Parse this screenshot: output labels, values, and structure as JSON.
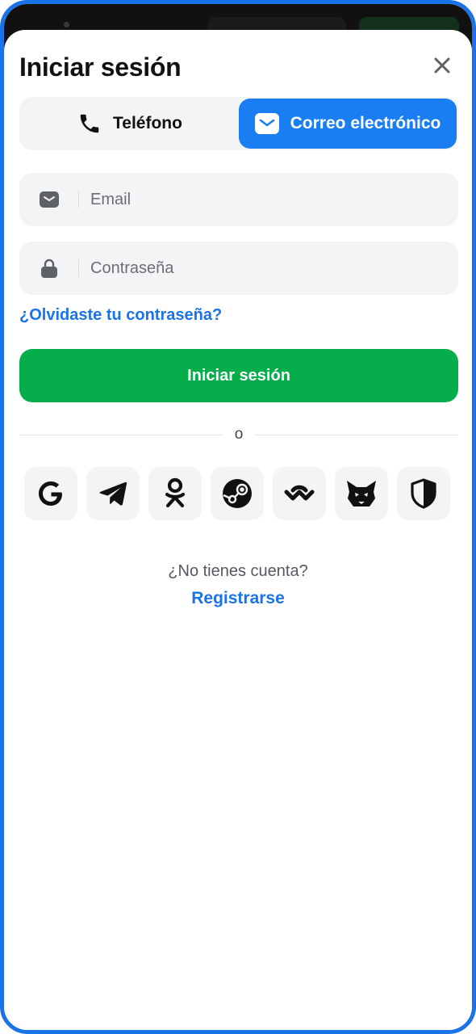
{
  "header": {
    "title": "Iniciar sesión"
  },
  "tabs": [
    {
      "label": "Teléfono",
      "icon": "phone-icon",
      "active": false
    },
    {
      "label": "Correo electrónico",
      "icon": "mail-icon",
      "active": true
    }
  ],
  "form": {
    "email_placeholder": "Email",
    "password_placeholder": "Contraseña",
    "forgot_link": "¿Olvidaste tu contraseña?",
    "submit_label": "Iniciar sesión"
  },
  "divider_text": "o",
  "social_providers": [
    "google-icon",
    "telegram-icon",
    "odnoklassniki-icon",
    "steam-icon",
    "walletconnect-icon",
    "metamask-icon",
    "shield-icon"
  ],
  "footer": {
    "prompt": "¿No tienes cuenta?",
    "register_link": "Registrarse"
  },
  "colors": {
    "accent": "#1a7ef2",
    "link": "#1a73e8",
    "primary_button": "#05ae4a",
    "frame_border": "#1a73e8"
  }
}
